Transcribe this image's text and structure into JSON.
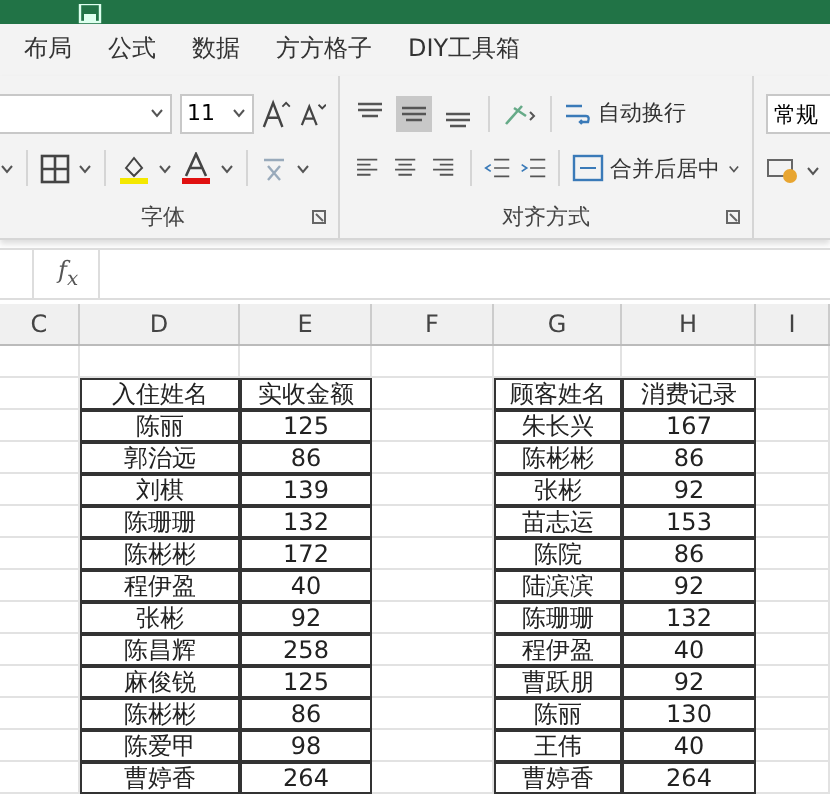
{
  "tabs": [
    {
      "label": "布局",
      "selected": false
    },
    {
      "label": "公式",
      "selected": false
    },
    {
      "label": "数据",
      "selected": false
    },
    {
      "label": "方方格子",
      "selected": false
    },
    {
      "label": "DIY工具箱",
      "selected": false
    }
  ],
  "font_group": {
    "font_size": "11",
    "label": "字体"
  },
  "alignment_group": {
    "top_align": [
      {
        "on": false
      },
      {
        "on": true
      },
      {
        "on": false
      }
    ],
    "wrap_text": "自动换行",
    "merge": "合并后居中",
    "label": "对齐方式"
  },
  "number_group": {
    "format": "常规"
  },
  "formula_bar": {
    "fx": "f$_{x}$"
  },
  "columns": [
    "C",
    "D",
    "E",
    "F",
    "G",
    "H",
    "I"
  ],
  "tables": [
    {
      "columns": [
        "入住姓名",
        "实收金额"
      ],
      "rows": [
        [
          "陈丽",
          "125"
        ],
        [
          "郭治远",
          "86"
        ],
        [
          "刘棋",
          "139"
        ],
        [
          "陈珊珊",
          "132"
        ],
        [
          "陈彬彬",
          "172"
        ],
        [
          "程伊盈",
          "40"
        ],
        [
          "张彬",
          "92"
        ],
        [
          "陈昌辉",
          "258"
        ],
        [
          "麻俊锐",
          "125"
        ],
        [
          "陈彬彬",
          "86"
        ],
        [
          "陈爱甲",
          "98"
        ],
        [
          "曹婷香",
          "264"
        ]
      ]
    },
    {
      "columns": [
        "顾客姓名",
        "消费记录"
      ],
      "rows": [
        [
          "朱长兴",
          "167"
        ],
        [
          "陈彬彬",
          "86"
        ],
        [
          "张彬",
          "92"
        ],
        [
          "苗志运",
          "153"
        ],
        [
          "陈院",
          "86"
        ],
        [
          "陆滨滨",
          "92"
        ],
        [
          "陈珊珊",
          "132"
        ],
        [
          "程伊盈",
          "40"
        ],
        [
          "曹跃朋",
          "92"
        ],
        [
          "陈丽",
          "130"
        ],
        [
          "王伟",
          "40"
        ],
        [
          "曹婷香",
          "264"
        ]
      ]
    }
  ]
}
